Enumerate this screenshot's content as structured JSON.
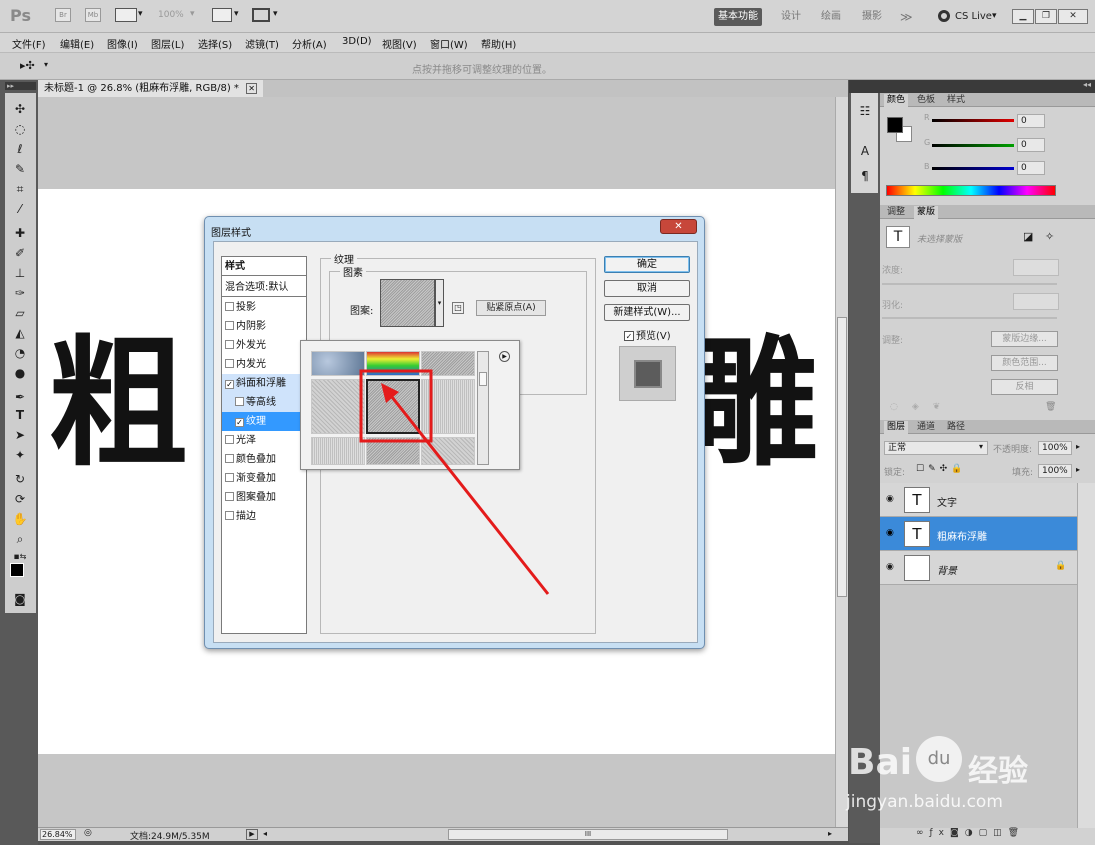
{
  "titlebar": {
    "logo": "Ps",
    "icon_bridge": "Br",
    "icon_minibridge": "Mb",
    "zoom_value": "100%",
    "workspaces": [
      "基本功能",
      "设计",
      "绘画",
      "摄影"
    ],
    "more": "≫",
    "cslive": "CS Live",
    "dropdown_arrow": "▾"
  },
  "menubar": {
    "items": [
      "文件(F)",
      "编辑(E)",
      "图像(I)",
      "图层(L)",
      "选择(S)",
      "滤镜(T)",
      "分析(A)",
      "3D(D)",
      "视图(V)",
      "窗口(W)",
      "帮助(H)"
    ]
  },
  "optionsbar": {
    "tool_glyph": "▸✣",
    "hint": "点按并拖移可调整纹理的位置。"
  },
  "document": {
    "tab_label": "未标题-1 @ 26.8% (粗麻布浮雕, RGB/8) *",
    "tab_close": "✕",
    "char_left": "粗",
    "char_right": "雕"
  },
  "statusbar": {
    "zoom": "26.84%",
    "doc_size": "文档:24.9M/5.35M"
  },
  "color_panel": {
    "tabs": [
      "颜色",
      "色板",
      "样式"
    ],
    "channels": [
      {
        "label": "R",
        "value": "0",
        "color": "#e00000"
      },
      {
        "label": "G",
        "value": "0",
        "color": "#00a000"
      },
      {
        "label": "B",
        "value": "0",
        "color": "#0000d0"
      }
    ]
  },
  "masks_panel": {
    "tabs": [
      "调整",
      "蒙版"
    ],
    "no_mask": "未选择蒙版",
    "density_label": "浓度:",
    "feather_label": "羽化:",
    "refine_label": "调整:",
    "btn_mask_edge": "蒙版边缘...",
    "btn_color_range": "颜色范围...",
    "btn_invert": "反相"
  },
  "layers_panel": {
    "tabs": [
      "图层",
      "通道",
      "路径"
    ],
    "blend_mode": "正常",
    "opacity_label": "不透明度:",
    "opacity_value": "100%",
    "lock_label": "锁定:",
    "fill_label": "填充:",
    "fill_value": "100%",
    "layers": [
      {
        "name": "文字",
        "thumb": "T"
      },
      {
        "name": "粗麻布浮雕",
        "thumb": "T"
      },
      {
        "name": "背景",
        "thumb": ""
      }
    ]
  },
  "dialog": {
    "title": "图层样式",
    "close": "✕",
    "style_header": "样式",
    "blend_options": "混合选项:默认",
    "styles": [
      {
        "label": "投影",
        "checked": ""
      },
      {
        "label": "内阴影",
        "checked": ""
      },
      {
        "label": "外发光",
        "checked": ""
      },
      {
        "label": "内发光",
        "checked": ""
      },
      {
        "label": "斜面和浮雕",
        "checked": "✓"
      },
      {
        "label": "等高线",
        "checked": ""
      },
      {
        "label": "纹理",
        "checked": "✓"
      },
      {
        "label": "光泽",
        "checked": ""
      },
      {
        "label": "颜色叠加",
        "checked": ""
      },
      {
        "label": "渐变叠加",
        "checked": ""
      },
      {
        "label": "图案叠加",
        "checked": ""
      },
      {
        "label": "描边",
        "checked": ""
      }
    ],
    "texture_group": "纹理",
    "elements_group": "图素",
    "pattern_label": "图案:",
    "snap_origin": "贴紧原点(A)",
    "ok": "确定",
    "cancel": "取消",
    "new_style": "新建样式(W)...",
    "preview_label": "预览(V)",
    "preview_checked": "✓"
  },
  "watermark": {
    "brand": "Bai",
    "brand2": "经验",
    "url": "jingyan.baidu.com"
  }
}
